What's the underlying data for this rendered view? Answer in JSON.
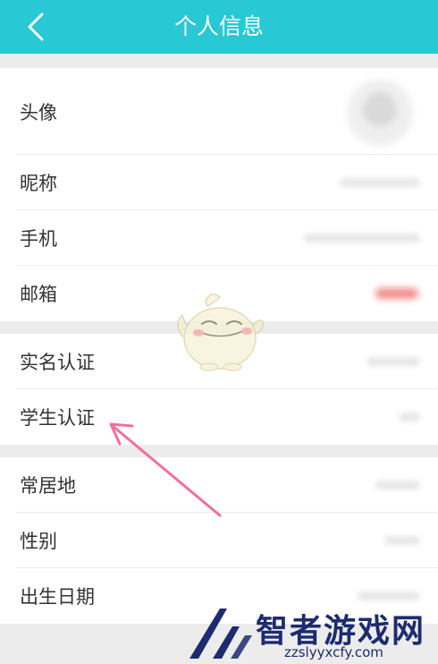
{
  "header": {
    "title": "个人信息",
    "back_icon": "chevron-left-icon",
    "background": "#28c8d4"
  },
  "sections": [
    {
      "items": [
        {
          "label": "头像",
          "value_type": "avatar"
        },
        {
          "label": "昵称",
          "value_type": "blurred"
        },
        {
          "label": "手机",
          "value_type": "blurred"
        },
        {
          "label": "邮箱",
          "value_type": "blurred-red"
        }
      ]
    },
    {
      "items": [
        {
          "label": "实名认证",
          "value_type": "blurred"
        },
        {
          "label": "学生认证",
          "value_type": "blurred"
        }
      ]
    },
    {
      "items": [
        {
          "label": "常居地",
          "value_type": "blurred"
        },
        {
          "label": "性别",
          "value_type": "blurred"
        },
        {
          "label": "出生日期",
          "value_type": "blurred"
        }
      ]
    }
  ],
  "annotation": {
    "arrow_color": "#f0709a",
    "target": "学生认证"
  },
  "watermark": {
    "title": "智者游戏网",
    "url": "zzslyyxcfy.com",
    "color": "#1d2b6f"
  }
}
